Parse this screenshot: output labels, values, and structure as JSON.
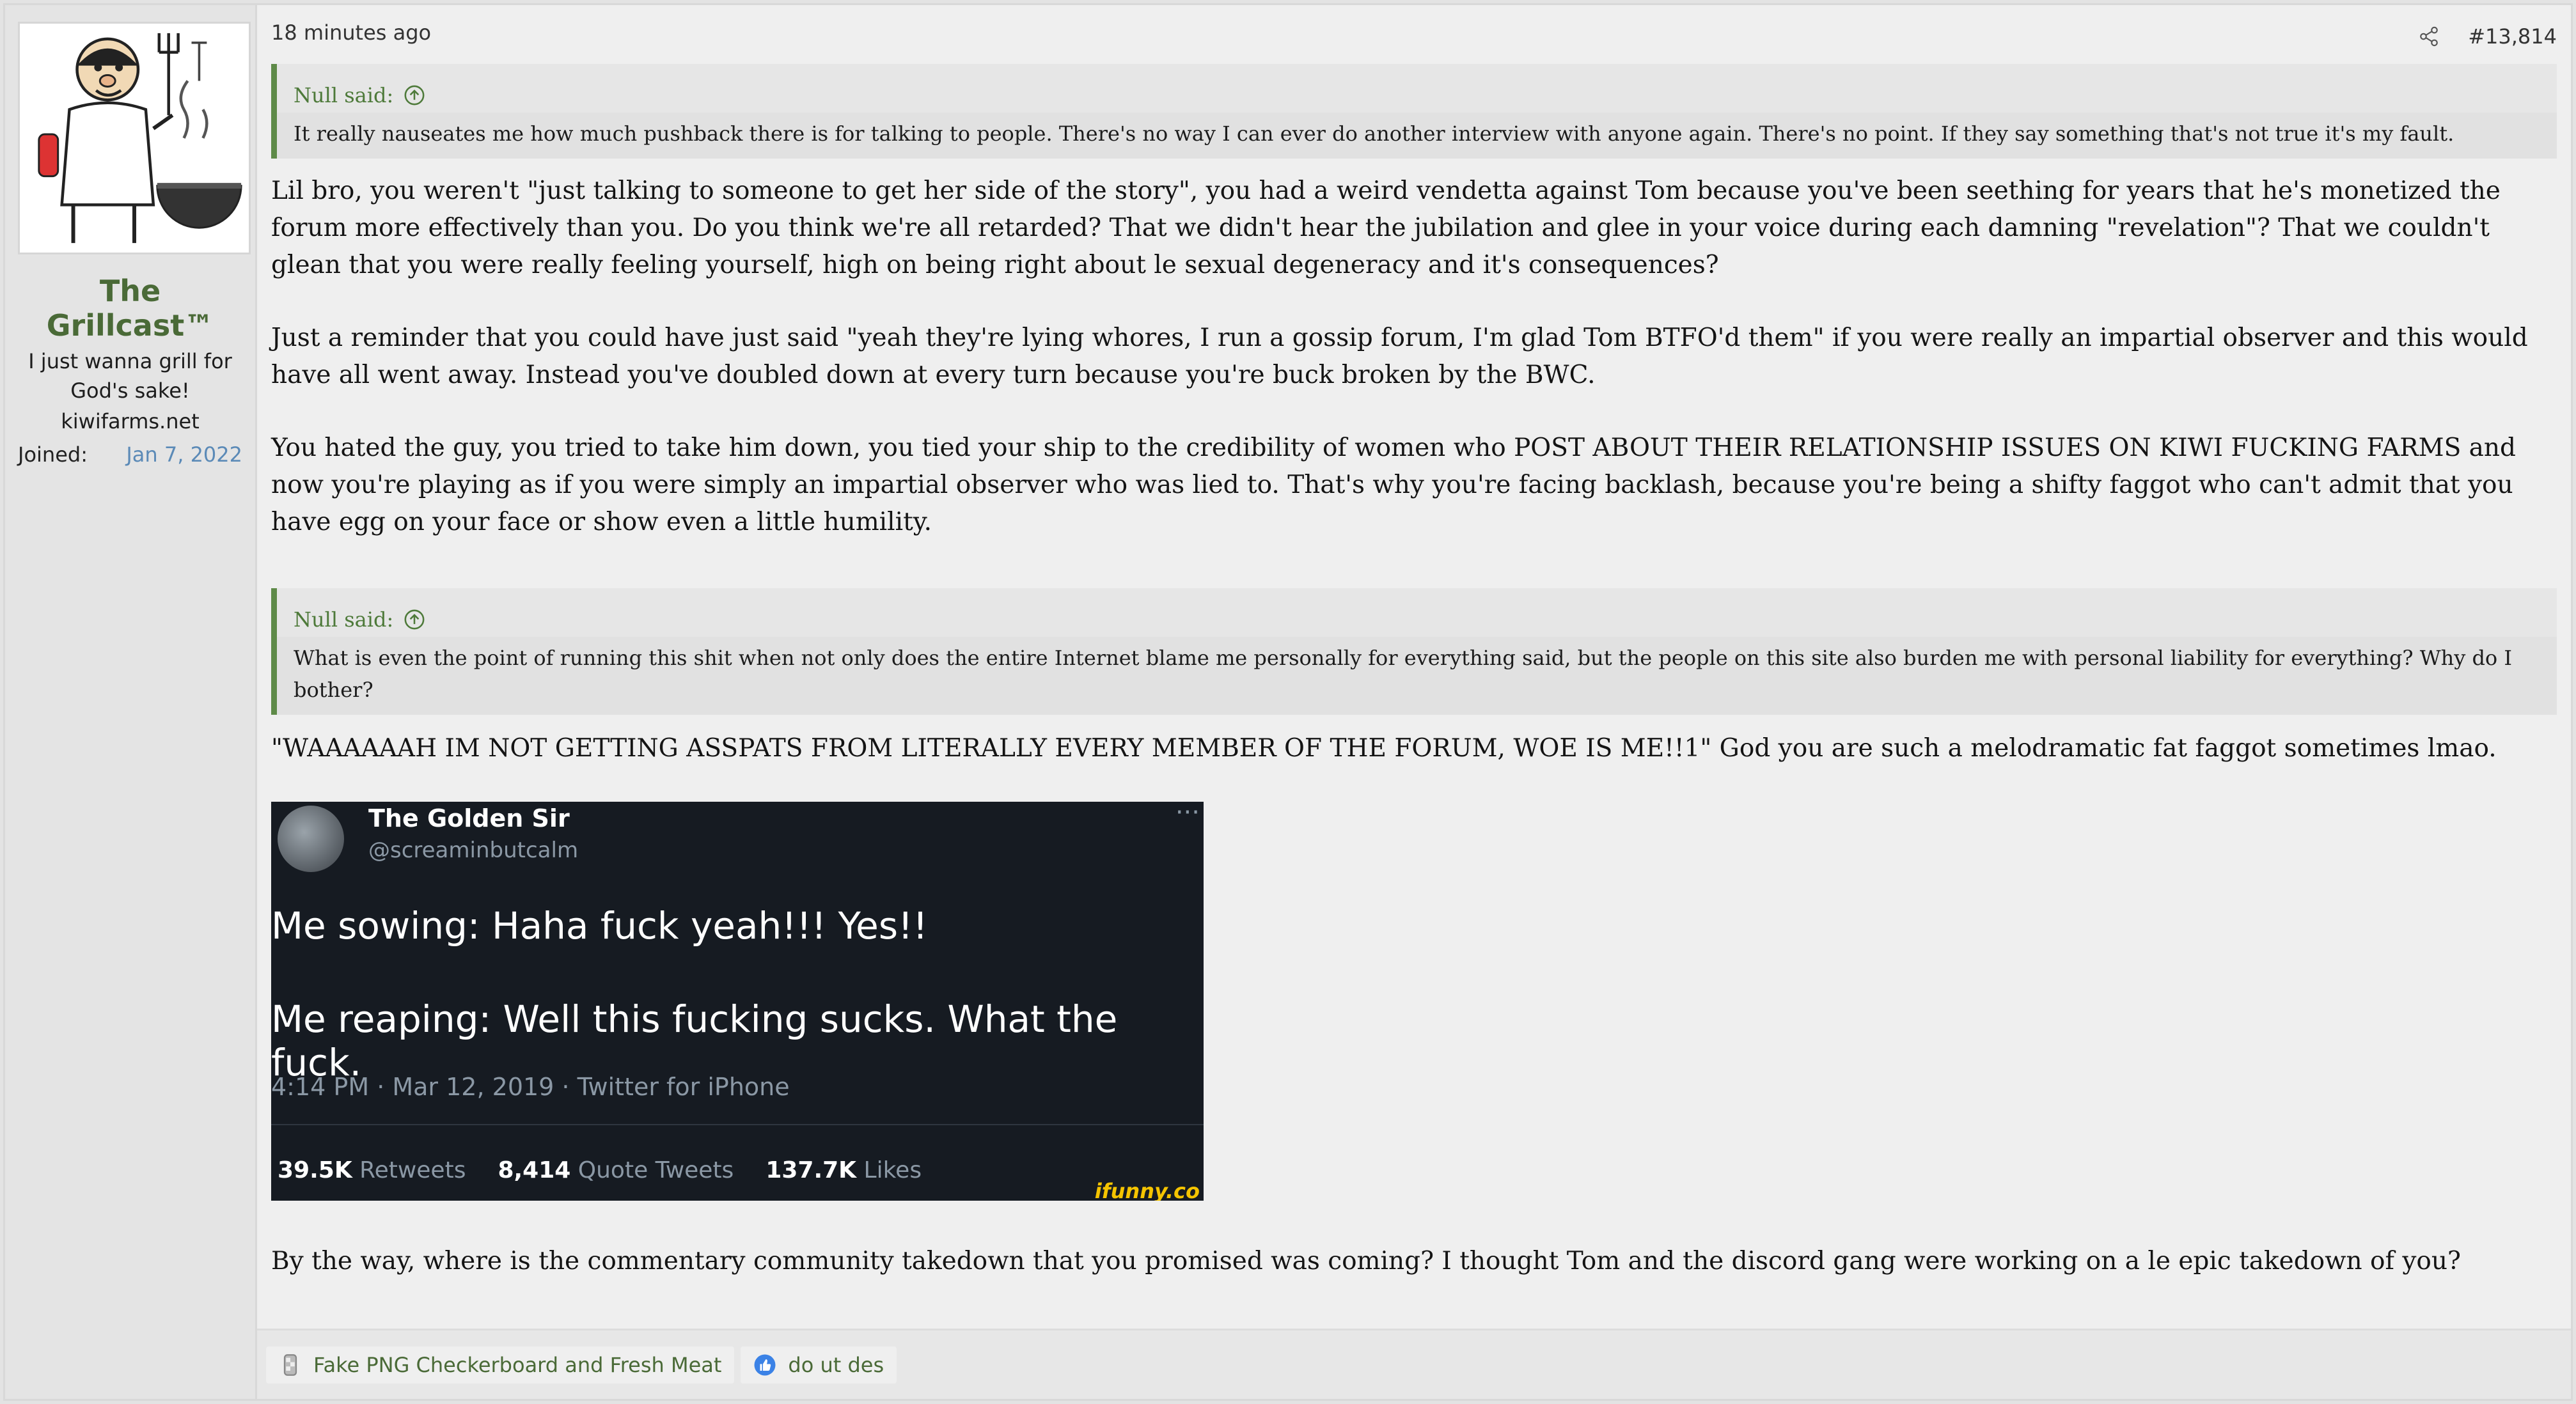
{
  "user": {
    "name": "The Grillcast™",
    "title": "I just wanna grill for God's sake!",
    "banner": "kiwifarms.net",
    "joined_label": "Joined:",
    "joined_value": "Jan 7, 2022"
  },
  "post": {
    "timestamp": "18 minutes ago",
    "number": "#13,814",
    "quote1": {
      "author": "Null said:",
      "text": "It really nauseates me how much pushback there is for talking to people. There's no way I can ever do another interview with anyone again. There's no point. If they say something that's not true it's my fault."
    },
    "para1": "Lil bro, you weren't \"just talking to someone to get her side of the story\", you had a weird vendetta against Tom because you've been seething for years that he's monetized the forum more effectively than you. Do you think we're all retarded? That we didn't hear the jubilation and glee in your voice during each damning \"revelation\"? That we couldn't glean that you were really feeling yourself, high on being right about le sexual degeneracy and it's consequences?",
    "para2": "Just a reminder that you could have just said \"yeah they're lying whores, I run a gossip forum, I'm glad Tom BTFO'd them\" if you were really an impartial observer and this would have all went away. Instead you've doubled down at every turn because you're buck broken by the BWC.",
    "para3": "You hated the guy, you tried to take him down, you tied your ship to the credibility of women who POST ABOUT THEIR RELATIONSHIP ISSUES ON KIWI FUCKING FARMS and now you're playing as if you were simply an impartial observer who was lied to. That's why you're facing backlash, because you're being a shifty faggot who can't admit that you have egg on your face or show even a little humility.",
    "quote2": {
      "author": "Null said:",
      "text": "What is even the point of running this shit when not only does the entire Internet blame me personally for everything said, but the people on this site also burden me with personal liability for everything? Why do I bother?"
    },
    "para4": "\"WAAAAAAH IM NOT GETTING ASSPATS FROM LITERALLY EVERY MEMBER OF THE FORUM, WOE IS ME!!1\" God you are such a melodramatic fat faggot sometimes lmao.",
    "tweet": {
      "name": "The Golden Sir",
      "handle": "@screaminbutcalm",
      "line1": "Me sowing: Haha fuck yeah!!! Yes!!",
      "line2": "Me reaping: Well this fucking sucks. What the fuck.",
      "time": "4:14 PM · Mar 12, 2019 · Twitter for iPhone",
      "retweets_num": "39.5K",
      "retweets_lbl": "Retweets",
      "quotes_num": "8,414",
      "quotes_lbl": "Quote Tweets",
      "likes_num": "137.7K",
      "likes_lbl": "Likes",
      "watermark": "ifunny.co"
    },
    "para5": "By the way, where is the commentary community takedown that you promised was coming? I thought Tom and the discord gang were working on a le epic takedown of you?"
  },
  "reactions": [
    {
      "label": "Fake PNG Checkerboard and Fresh Meat",
      "icon": "checkerboard-icon"
    },
    {
      "label": "do ut des",
      "icon": "thumbs-up-icon"
    }
  ],
  "colors": {
    "accent": "#5e8a48",
    "username": "#4a6a37",
    "link": "#5b8ab7"
  }
}
